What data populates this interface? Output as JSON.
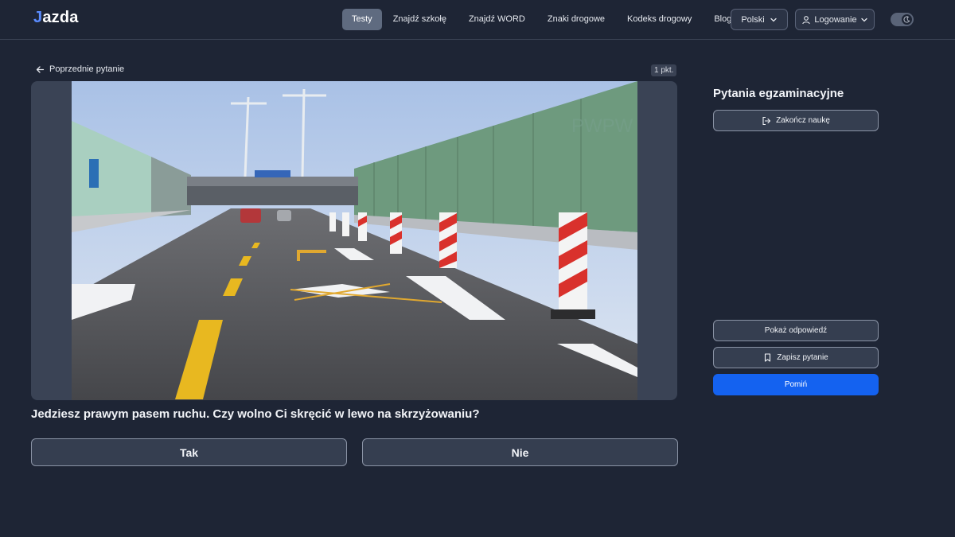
{
  "app": {
    "logo_mark": "J",
    "logo_text": "azda"
  },
  "nav": {
    "items": [
      {
        "label": "Testy",
        "active": true
      },
      {
        "label": "Znajdź szkołę",
        "active": false
      },
      {
        "label": "Znajdź WORD",
        "active": false
      },
      {
        "label": "Znaki drogowe",
        "active": false
      },
      {
        "label": "Kodeks drogowy",
        "active": false
      },
      {
        "label": "Blog",
        "active": false
      }
    ],
    "language": "Polski",
    "login": "Logowanie"
  },
  "question": {
    "back_label": "Poprzednie pytanie",
    "points": "1 pkt.",
    "image_watermark": "PWPW",
    "text": "Jedziesz prawym pasem ruchu. Czy wolno Ci skręcić w lewo na skrzyżowaniu?",
    "answers": [
      "Tak",
      "Nie"
    ]
  },
  "sidebar": {
    "title": "Pytania egzaminacyjne",
    "finish_label": "Zakończ naukę",
    "show_answer_label": "Pokaż odpowiedź",
    "save_label": "Zapisz pytanie",
    "skip_label": "Pomiń"
  },
  "colors": {
    "background": "#1e2535",
    "accent": "#1462f0",
    "card": "#353e50"
  }
}
